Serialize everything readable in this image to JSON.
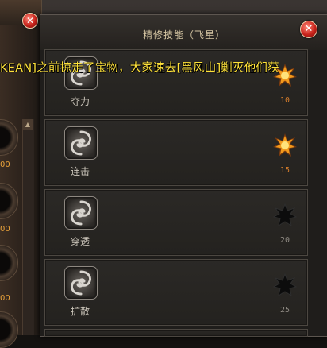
{
  "window": {
    "title": "精修技能（飞星）",
    "close_glyph": "✕"
  },
  "announcement": {
    "text": "KEAN]之前掠走了宝物，大家速去[黑风山]剿灭他们获"
  },
  "left_panel": {
    "close_glyph": "✕",
    "scroll_up_glyph": "▲",
    "slots": [
      {
        "value": "00"
      },
      {
        "value": "00"
      },
      {
        "value": "00"
      },
      {
        "value": "00"
      }
    ]
  },
  "skills": [
    {
      "name": "夺力",
      "level": "10",
      "unlocked": true
    },
    {
      "name": "连击",
      "level": "15",
      "unlocked": true
    },
    {
      "name": "穿透",
      "level": "20",
      "unlocked": false
    },
    {
      "name": "扩散",
      "level": "25",
      "unlocked": false
    }
  ],
  "colors": {
    "announcement": "#ffe23a",
    "title": "#d7c7a4",
    "level_unlocked": "#d37c2c",
    "level_locked": "#8f8a83"
  }
}
